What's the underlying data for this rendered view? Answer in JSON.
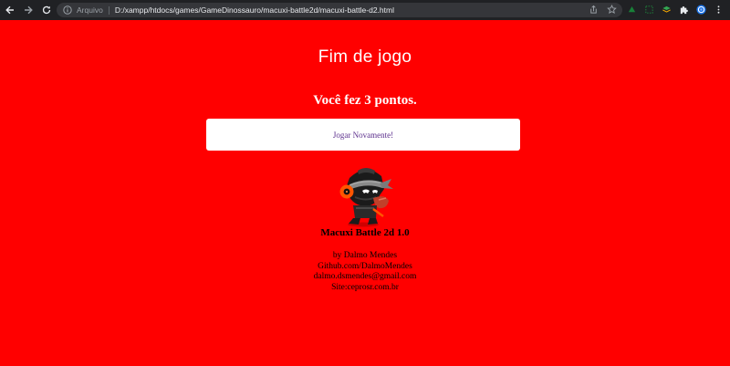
{
  "browser": {
    "scheme_label": "Arquivo",
    "url": "D:/xampp/htdocs/games/GameDinossauro/macuxi-battle2d/macuxi-battle-d2.html"
  },
  "page": {
    "background_color": "#ff0000",
    "heading": "Fim de jogo",
    "score_text": "Você fez 3 pontos.",
    "play_again_label": "Jogar Novamente!",
    "game_title": "Macuxi Battle 2d 1.0",
    "credits": [
      "by Dalmo Mendes",
      "Github.com/DalmoMendes",
      "dalmo.dsmendes@gmail.com",
      "Site:ceprosr.com.br"
    ]
  }
}
